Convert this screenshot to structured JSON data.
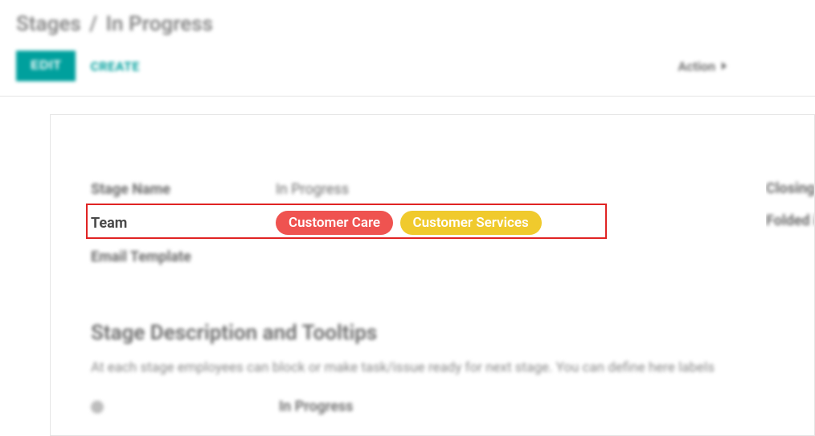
{
  "breadcrumb": {
    "root": "Stages",
    "sep": "/",
    "current": "In Progress"
  },
  "toolbar": {
    "edit": "EDIT",
    "create": "CREATE",
    "action": "Action"
  },
  "fields": {
    "stage_name": {
      "label": "Stage Name",
      "value": "In Progress"
    },
    "team": {
      "label": "Team",
      "tags": [
        {
          "text": "Customer Care",
          "color": "red"
        },
        {
          "text": "Customer Services",
          "color": "yellow"
        }
      ]
    },
    "email_template": {
      "label": "Email Template",
      "value": ""
    }
  },
  "right": {
    "closing_label": "Closing Kanban Stage",
    "folded_label": "Folded in Kanban"
  },
  "section": {
    "title": "Stage Description and Tooltips",
    "desc": "At each stage employees can block or make task/issue ready for next stage. You can define here labels",
    "sub_value": "In Progress"
  }
}
